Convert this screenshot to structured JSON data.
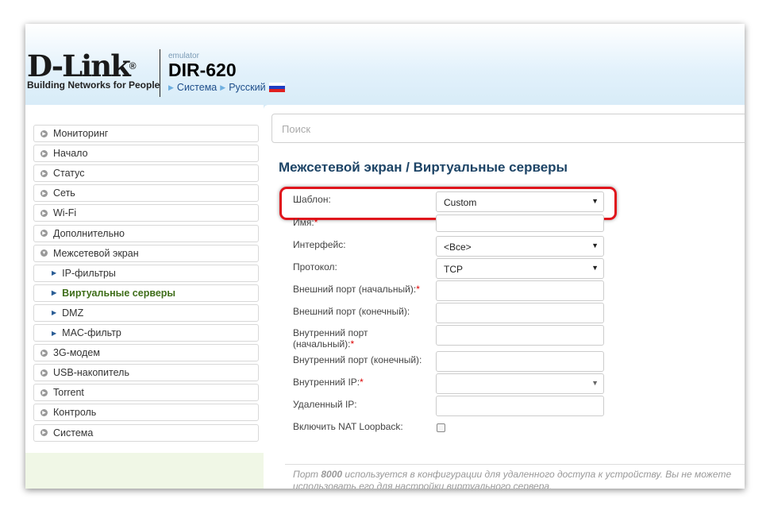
{
  "header": {
    "brand": "D-Link",
    "registered": "®",
    "tagline": "Building Networks for People",
    "emulator": "emulator",
    "model": "DIR-620",
    "crumbs": [
      "Система",
      "Русский"
    ]
  },
  "sidebar": {
    "items": [
      {
        "label": "Мониторинг",
        "sub": false
      },
      {
        "label": "Начало",
        "sub": false
      },
      {
        "label": "Статус",
        "sub": false
      },
      {
        "label": "Сеть",
        "sub": false
      },
      {
        "label": "Wi-Fi",
        "sub": false
      },
      {
        "label": "Дополнительно",
        "sub": false
      },
      {
        "label": "Межсетевой экран",
        "sub": false,
        "open": true
      },
      {
        "label": "IP-фильтры",
        "sub": true
      },
      {
        "label": "Виртуальные серверы",
        "sub": true,
        "active": true
      },
      {
        "label": "DMZ",
        "sub": true
      },
      {
        "label": "MAC-фильтр",
        "sub": true
      },
      {
        "label": "3G-модем",
        "sub": false
      },
      {
        "label": "USB-накопитель",
        "sub": false
      },
      {
        "label": "Torrent",
        "sub": false
      },
      {
        "label": "Контроль",
        "sub": false
      },
      {
        "label": "Система",
        "sub": false
      }
    ]
  },
  "search": {
    "placeholder": "Поиск"
  },
  "page": {
    "title": "Межсетевой экран /  Виртуальные серверы"
  },
  "form": {
    "template": {
      "label": "Шаблон:",
      "value": "Custom"
    },
    "name": {
      "label": "Имя:",
      "value": ""
    },
    "interface": {
      "label": "Интерфейс:",
      "value": "<Все>"
    },
    "protocol": {
      "label": "Протокол:",
      "value": "TCP"
    },
    "ext_start": {
      "label": "Внешний порт (начальный):",
      "value": ""
    },
    "ext_end": {
      "label": "Внешний порт (конечный):",
      "value": ""
    },
    "int_start": {
      "label": "Внутренний порт (начальный):",
      "value": ""
    },
    "int_end": {
      "label": "Внутренний порт (конечный):",
      "value": ""
    },
    "int_ip": {
      "label": "Внутренний IP:",
      "value": ""
    },
    "remote_ip": {
      "label": "Удаленный IP:",
      "value": ""
    },
    "nat_loopback": {
      "label": "Включить NAT Loopback:",
      "checked": false
    }
  },
  "note": {
    "prefix": "Порт ",
    "port": "8000",
    "text": " используется в конфигурации для удаленного доступа к устройству. Вы не можете использовать его для настройки виртуального сервера."
  },
  "colors": {
    "highlight": "#e0141c",
    "title": "#1d4466",
    "active": "#3f6e1a"
  }
}
